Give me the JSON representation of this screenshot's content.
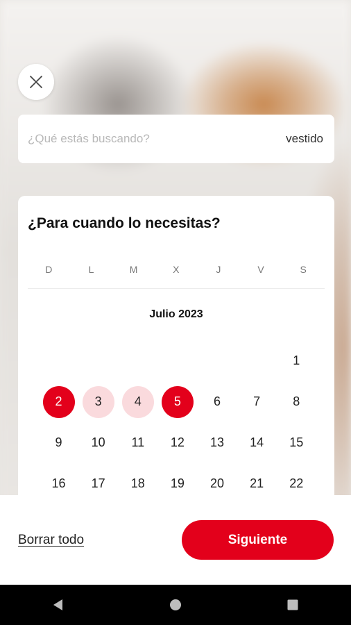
{
  "status_bar": {
    "time": "",
    "icons": ""
  },
  "search": {
    "label": "¿Qué estás buscando?",
    "value": "vestido"
  },
  "calendar": {
    "title": "¿Para cuando lo necesitas?",
    "weekdays": [
      "D",
      "L",
      "M",
      "X",
      "J",
      "V",
      "S"
    ],
    "month": "Julio 2023",
    "weeks": [
      [
        "",
        "",
        "",
        "",
        "",
        "",
        "1"
      ],
      [
        "2",
        "3",
        "4",
        "5",
        "6",
        "7",
        "8"
      ],
      [
        "9",
        "10",
        "11",
        "12",
        "13",
        "14",
        "15"
      ],
      [
        "16",
        "17",
        "18",
        "19",
        "20",
        "21",
        "22"
      ]
    ],
    "selected_start": "2",
    "selected_end": "5",
    "in_range": [
      "3",
      "4"
    ]
  },
  "footer": {
    "clear_label": "Borrar todo",
    "next_label": "Siguiente"
  },
  "colors": {
    "accent": "#e3001b",
    "range": "#fadadd"
  },
  "icons": {
    "close": "close-icon",
    "back": "back-triangle-icon",
    "home": "home-circle-icon",
    "recents": "recents-square-icon"
  }
}
